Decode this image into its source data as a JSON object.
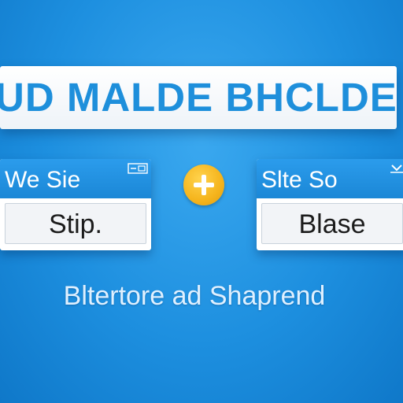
{
  "banner": {
    "title": "UD MALDE BHCLDE"
  },
  "left_window": {
    "title": "We Sie",
    "value": "Stip."
  },
  "right_window": {
    "title": "Slte So",
    "value": "Blase"
  },
  "plus_button": {
    "icon": "plus-icon"
  },
  "caption": {
    "text": "Bltertore ad Shaprend"
  },
  "colors": {
    "background": "#1d8fdf",
    "title_blue": "#1e8fdb",
    "window_header": "#2b9cec",
    "plus_button": "#f5b41c"
  }
}
